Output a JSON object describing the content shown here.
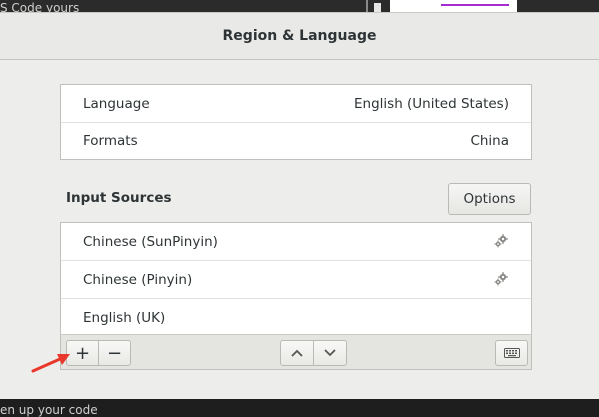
{
  "background": {
    "top_text": "S Code yours",
    "bottom_text": "en up your code"
  },
  "dialog": {
    "title": "Region & Language",
    "language_rows": [
      {
        "label": "Language",
        "value": "English (United States)"
      },
      {
        "label": "Formats",
        "value": "China"
      }
    ],
    "input_sources_label": "Input Sources",
    "options_label": "Options",
    "input_sources": [
      {
        "name": "Chinese (SunPinyin)",
        "icon": "gear-icon"
      },
      {
        "name": "Chinese (Pinyin)",
        "icon": "gear-icon"
      },
      {
        "name": "English (UK)",
        "icon": ""
      }
    ],
    "toolbar": {
      "add_symbol": "+",
      "remove_symbol": "−",
      "icons": [
        "move-up-icon",
        "move-down-icon",
        "keyboard-icon"
      ]
    }
  },
  "colors": {
    "annotation_arrow": "#e8382b",
    "accent_purple": "#a62bd1"
  }
}
